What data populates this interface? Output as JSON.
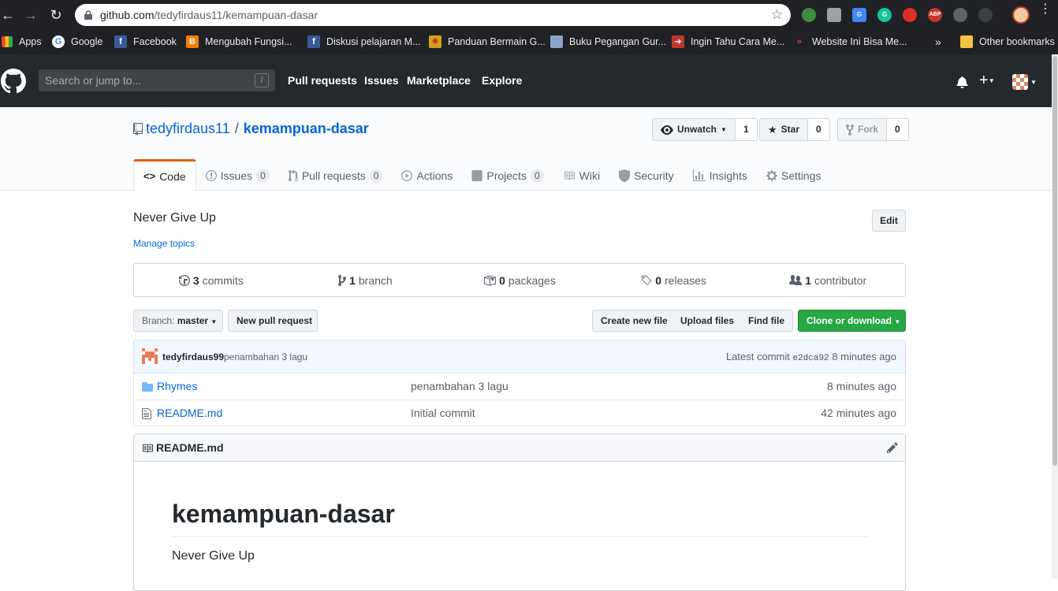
{
  "browser": {
    "url_host": "github.com",
    "url_path": "/tedyfirdaus11/kemampuan-dasar",
    "bookmarks": [
      {
        "label": "Apps",
        "icon": "apps-grid-icon",
        "color": "#e8453c"
      },
      {
        "label": "Google",
        "icon": "google-icon",
        "color": "#4285f4"
      },
      {
        "label": "Facebook",
        "icon": "facebook-icon",
        "color": "#3b5998"
      },
      {
        "label": "Mengubah Fungsi...",
        "icon": "blogger-icon",
        "color": "#f57d00"
      },
      {
        "label": "Diskusi pelajaran M...",
        "icon": "facebook-icon",
        "color": "#3b5998"
      },
      {
        "label": "Panduan Bermain G...",
        "icon": "star-burst-icon",
        "color": "#d4a017"
      },
      {
        "label": "Buku Pegangan Gur...",
        "icon": "site-thumbnail-icon",
        "color": "#8aa4c8"
      },
      {
        "label": "Ingin Tahu Cara Me...",
        "icon": "red-arrow-icon",
        "color": "#c0392b"
      },
      {
        "label": "Website Ini Bisa Me...",
        "icon": "red-chevron-icon",
        "color": "#c0392b"
      }
    ],
    "overflow_label": "»",
    "other_bookmarks": "Other bookmarks"
  },
  "header": {
    "search_placeholder": "Search or jump to...",
    "search_key": "/",
    "nav": [
      "Pull requests",
      "Issues",
      "Marketplace",
      "Explore"
    ]
  },
  "repo": {
    "owner": "tedyfirdaus11",
    "separator": "/",
    "name": "kemampuan-dasar",
    "watch_label": "Unwatch",
    "watch_count": "1",
    "star_label": "Star",
    "star_count": "0",
    "fork_label": "Fork",
    "fork_count": "0",
    "tabs": [
      {
        "label": "Code",
        "counter": ""
      },
      {
        "label": "Issues",
        "counter": "0"
      },
      {
        "label": "Pull requests",
        "counter": "0"
      },
      {
        "label": "Actions",
        "counter": ""
      },
      {
        "label": "Projects",
        "counter": "0"
      },
      {
        "label": "Wiki",
        "counter": ""
      },
      {
        "label": "Security",
        "counter": ""
      },
      {
        "label": "Insights",
        "counter": ""
      },
      {
        "label": "Settings",
        "counter": ""
      }
    ]
  },
  "main": {
    "description": "Never Give Up",
    "manage_topics": "Manage topics",
    "edit_label": "Edit",
    "summary": [
      {
        "num": "3",
        "label": "commits"
      },
      {
        "num": "1",
        "label": "branch"
      },
      {
        "num": "0",
        "label": "packages"
      },
      {
        "num": "0",
        "label": "releases"
      },
      {
        "num": "1",
        "label": "contributor"
      }
    ],
    "branch_label": "Branch:",
    "branch_value": "master",
    "new_pr": "New pull request",
    "create_file": "Create new file",
    "upload_files": "Upload files",
    "find_file": "Find file",
    "clone": "Clone or download",
    "commit": {
      "author": "tedyfirdaus99",
      "message": "penambahan 3 lagu",
      "latest_label": "Latest commit",
      "sha": "e2dca92",
      "age": "8 minutes ago"
    },
    "files": [
      {
        "type": "dir",
        "name": "Rhymes",
        "message": "penambahan 3 lagu",
        "age": "8 minutes ago"
      },
      {
        "type": "file",
        "name": "README.md",
        "message": "Initial commit",
        "age": "42 minutes ago"
      }
    ],
    "readme": {
      "filename": "README.md",
      "heading": "kemampuan-dasar",
      "body": "Never Give Up"
    }
  },
  "colors": {
    "link": "#0366d6",
    "header_bg": "#24292e",
    "green": "#28a745",
    "tab_accent": "#e36209"
  }
}
